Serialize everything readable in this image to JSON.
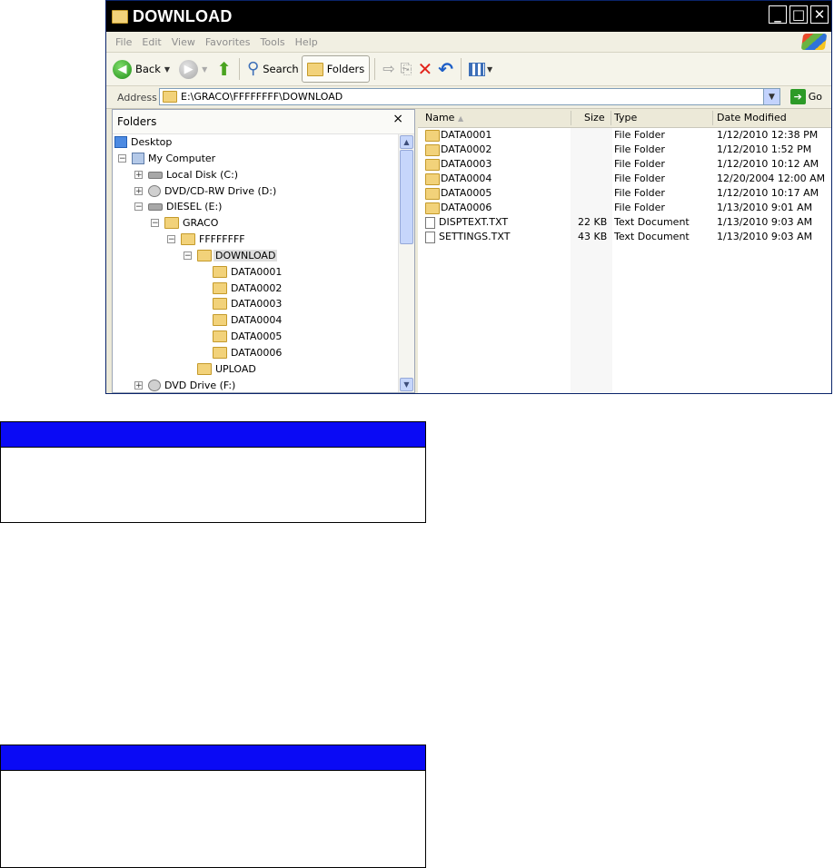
{
  "window": {
    "title": "DOWNLOAD",
    "menu": [
      "File",
      "Edit",
      "View",
      "Favorites",
      "Tools",
      "Help"
    ],
    "toolbar": {
      "back": "Back",
      "search": "Search",
      "folders": "Folders"
    },
    "address": {
      "label": "Address",
      "value": "E:\\GRACO\\FFFFFFFF\\DOWNLOAD",
      "go": "Go"
    }
  },
  "folders_pane": {
    "header": "Folders",
    "close": "×",
    "tree": [
      {
        "label": "Desktop"
      },
      {
        "label": "My Computer"
      },
      {
        "label": "Local Disk (C:)"
      },
      {
        "label": "DVD/CD-RW Drive (D:)"
      },
      {
        "label": "DIESEL (E:)"
      },
      {
        "label": "GRACO"
      },
      {
        "label": "FFFFFFFF"
      },
      {
        "label": "DOWNLOAD"
      },
      {
        "label": "DATA0001"
      },
      {
        "label": "DATA0002"
      },
      {
        "label": "DATA0003"
      },
      {
        "label": "DATA0004"
      },
      {
        "label": "DATA0005"
      },
      {
        "label": "DATA0006"
      },
      {
        "label": "UPLOAD"
      },
      {
        "label": "DVD Drive (F:)"
      }
    ]
  },
  "file_list": {
    "columns": [
      "Name",
      "Size",
      "Type",
      "Date Modified"
    ],
    "rows": [
      {
        "name": "DATA0001",
        "size": "",
        "type": "File Folder",
        "date": "1/12/2010 12:38 PM"
      },
      {
        "name": "DATA0002",
        "size": "",
        "type": "File Folder",
        "date": "1/12/2010 1:52 PM"
      },
      {
        "name": "DATA0003",
        "size": "",
        "type": "File Folder",
        "date": "1/12/2010 10:12 AM"
      },
      {
        "name": "DATA0004",
        "size": "",
        "type": "File Folder",
        "date": "12/20/2004 12:00 AM"
      },
      {
        "name": "DATA0005",
        "size": "",
        "type": "File Folder",
        "date": "1/12/2010 10:17 AM"
      },
      {
        "name": "DATA0006",
        "size": "",
        "type": "File Folder",
        "date": "1/13/2010 9:01 AM"
      },
      {
        "name": "DISPTEXT.TXT",
        "size": "22 KB",
        "type": "Text Document",
        "date": "1/13/2010 9:03 AM"
      },
      {
        "name": "SETTINGS.TXT",
        "size": "43 KB",
        "type": "Text Document",
        "date": "1/13/2010 9:03 AM"
      }
    ]
  },
  "colors": {
    "notice_bar": "#0a0af5",
    "titlebar": "#000000"
  }
}
